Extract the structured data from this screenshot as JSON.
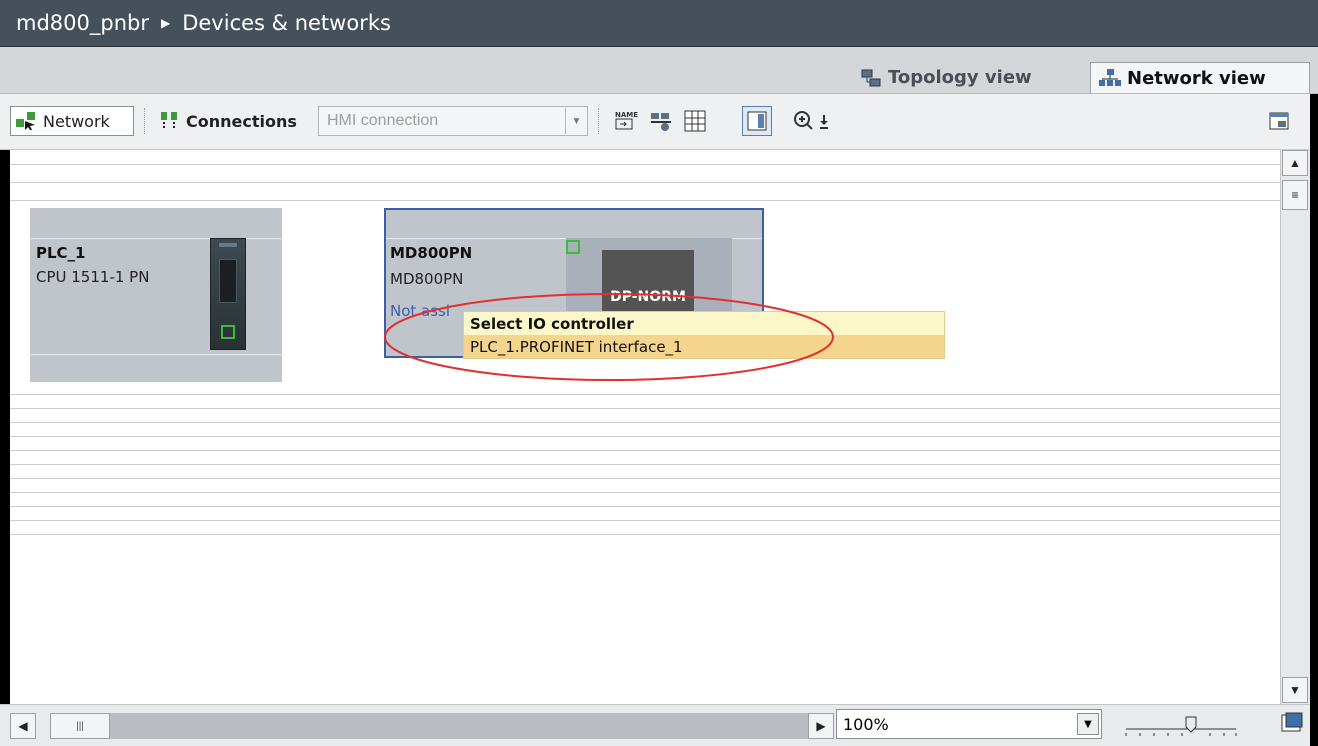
{
  "titlebar": {
    "project": "md800_pnbr",
    "separator": "▶",
    "section": "Devices & networks"
  },
  "view_tabs": {
    "topology": "Topology view",
    "network": "Network view"
  },
  "toolbar": {
    "network_label": "Network",
    "connections_label": "Connections",
    "connection_type_value": "HMI connection",
    "zoom_in_icon": "magnifier-plus-icon"
  },
  "devices": [
    {
      "name": "PLC_1",
      "type": "CPU 1511-1 PN"
    },
    {
      "name": "MD800PN",
      "type": "MD800PN",
      "status": "Not assi",
      "module": "DP-NORM"
    }
  ],
  "popup": {
    "header": "Select IO controller",
    "options": [
      "PLC_1.PROFINET interface_1"
    ],
    "highlight_color": "#f5d58e"
  },
  "bottom": {
    "zoom_value": "100%"
  },
  "colors": {
    "titlebar": "#46505a",
    "selection_border": "#3d5fa8",
    "port": "#3dbb3d",
    "annotation_ellipse": "#e03030"
  }
}
